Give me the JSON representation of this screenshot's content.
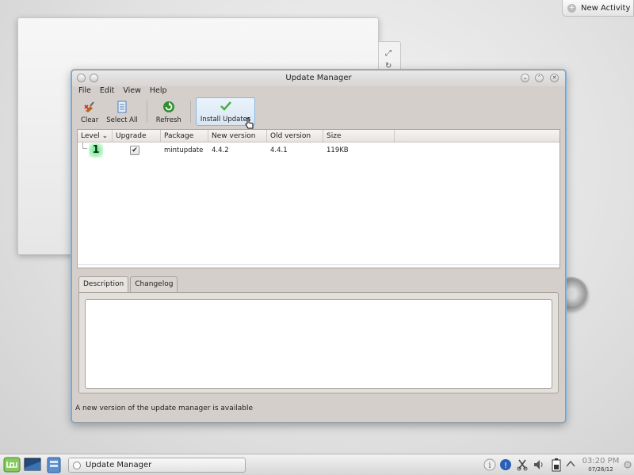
{
  "desktop": {
    "new_activity_label": "New Activity"
  },
  "window": {
    "title": "Update Manager",
    "menu": [
      "File",
      "Edit",
      "View",
      "Help"
    ],
    "toolbar": {
      "clear": "Clear",
      "select_all": "Select All",
      "refresh": "Refresh",
      "install_updates": "Install Updates"
    },
    "table": {
      "columns": [
        "Level",
        "Upgrade",
        "Package",
        "New version",
        "Old version",
        "Size"
      ],
      "rows": [
        {
          "level": "1",
          "upgrade": true,
          "package": "mintupdate",
          "new_version": "4.4.2",
          "old_version": "4.4.1",
          "size": "119KB"
        }
      ]
    },
    "tabs": [
      "Description",
      "Changelog"
    ],
    "description_text": "",
    "status": "A new version of the update manager is available"
  },
  "taskbar": {
    "task_label": "Update Manager",
    "time": "03:20 PM",
    "date": "07/26/12"
  },
  "colors": {
    "accent": "#7fb6e8",
    "window_bg": "#d4cfcb",
    "level_badge": "#8ef0a6"
  }
}
